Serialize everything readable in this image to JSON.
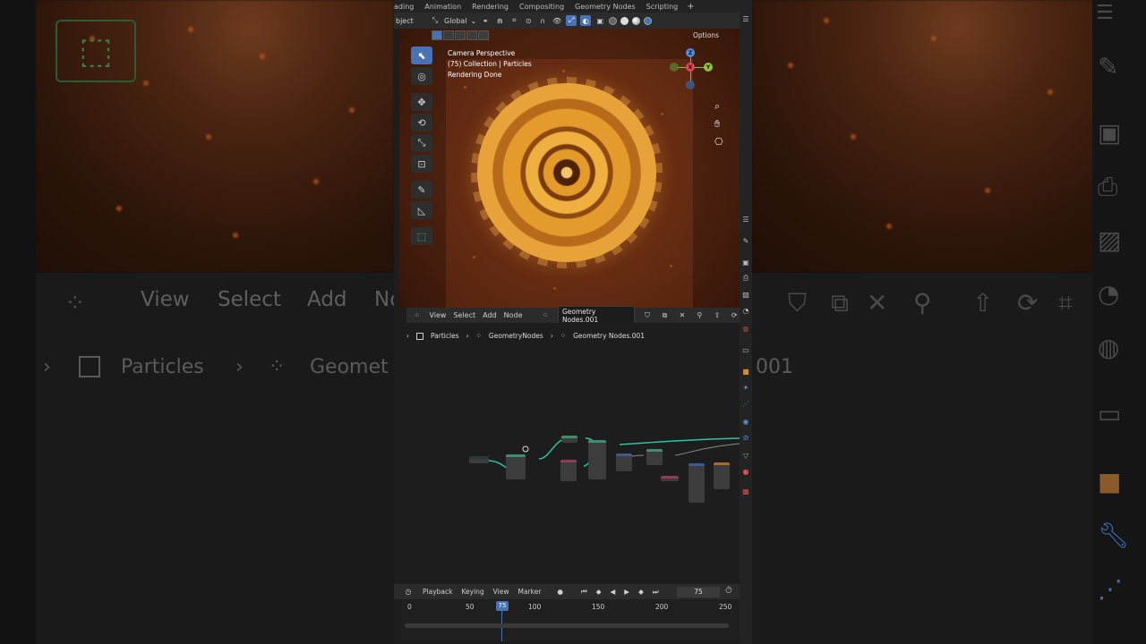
{
  "workspace_tabs": [
    "ading",
    "Animation",
    "Rendering",
    "Compositing",
    "Geometry Nodes",
    "Scripting"
  ],
  "workspace_add": "+",
  "viewport_header": {
    "mode": "bject",
    "transform_orientation": "Global",
    "options": "Options"
  },
  "viewport_overlay": {
    "line1": "Camera Perspective",
    "line2": "(75) Collection | Particles",
    "line3": "Rendering Done"
  },
  "gizmo": {
    "z": "Z",
    "x": "X",
    "y": "Y"
  },
  "node_editor": {
    "menu": [
      "View",
      "Select",
      "Add",
      "Node"
    ],
    "tree_name": "Geometry Nodes.001",
    "breadcrumb": [
      "Particles",
      "GeometryNodes",
      "Geometry Nodes.001"
    ]
  },
  "timeline": {
    "menu": [
      "Playback",
      "Keying",
      "View",
      "Marker"
    ],
    "current_frame": "75",
    "ticks": [
      "0",
      "50",
      "100",
      "150",
      "200",
      "250"
    ],
    "playhead_label": "75"
  },
  "background": {
    "menu": [
      "View",
      "Select",
      "Add",
      "No"
    ],
    "crumb1": "Particles",
    "crumb2": "Geomet",
    "crumb_right": "001"
  },
  "colors": {
    "accent": "#4772b3",
    "wire": "#2ec4a0",
    "render": "#e49b2a"
  }
}
